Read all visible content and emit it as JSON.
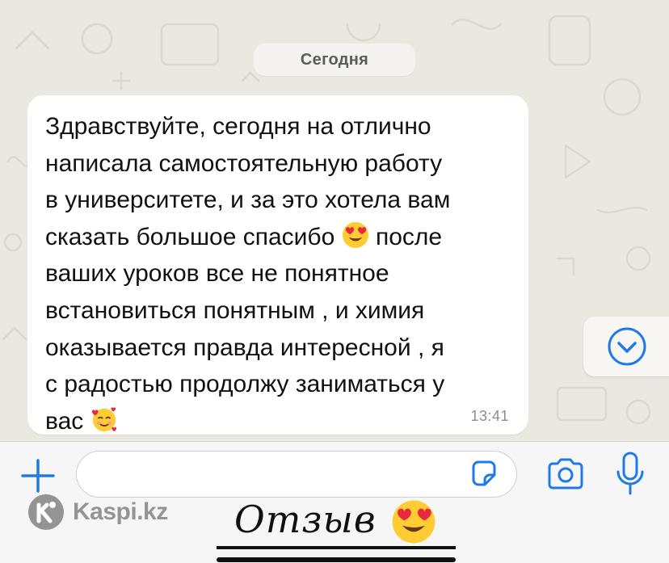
{
  "chat": {
    "date_label": "Сегодня",
    "message": {
      "lines": [
        "Здравствуйте, сегодня на отлично",
        "написала самостоятельную работу",
        "в университете, и за это хотела вам",
        "сказать большое спасибо",
        "после",
        "ваших уроков все не понятное",
        "встановиться понятным , и химия",
        "оказывается правда интересной , я",
        "с радостью продолжу заниматься у",
        "вас"
      ],
      "emoji_1": "heart-eyes-emoji",
      "emoji_2": "smiling-face-with-hearts-emoji",
      "time": "13:41"
    },
    "scroll_down_icon": "chevron-down-circle-icon"
  },
  "composer": {
    "plus_icon": "plus-icon",
    "input_value": "",
    "sticker_icon": "sticker-icon",
    "camera_icon": "camera-icon",
    "mic_icon": "microphone-icon"
  },
  "overlay": {
    "watermark_text": "Kaspi.kz",
    "watermark_icon": "kaspi-logo-icon",
    "review_label": "Отзыв",
    "review_emoji": "heart-eyes-emoji"
  },
  "colors": {
    "accent": "#1f7ae8",
    "chat_background": "#ebe8e2",
    "bubble": "#ffffff",
    "emoji_yellow": "#ffcc33",
    "heart_red": "#e8283c"
  }
}
